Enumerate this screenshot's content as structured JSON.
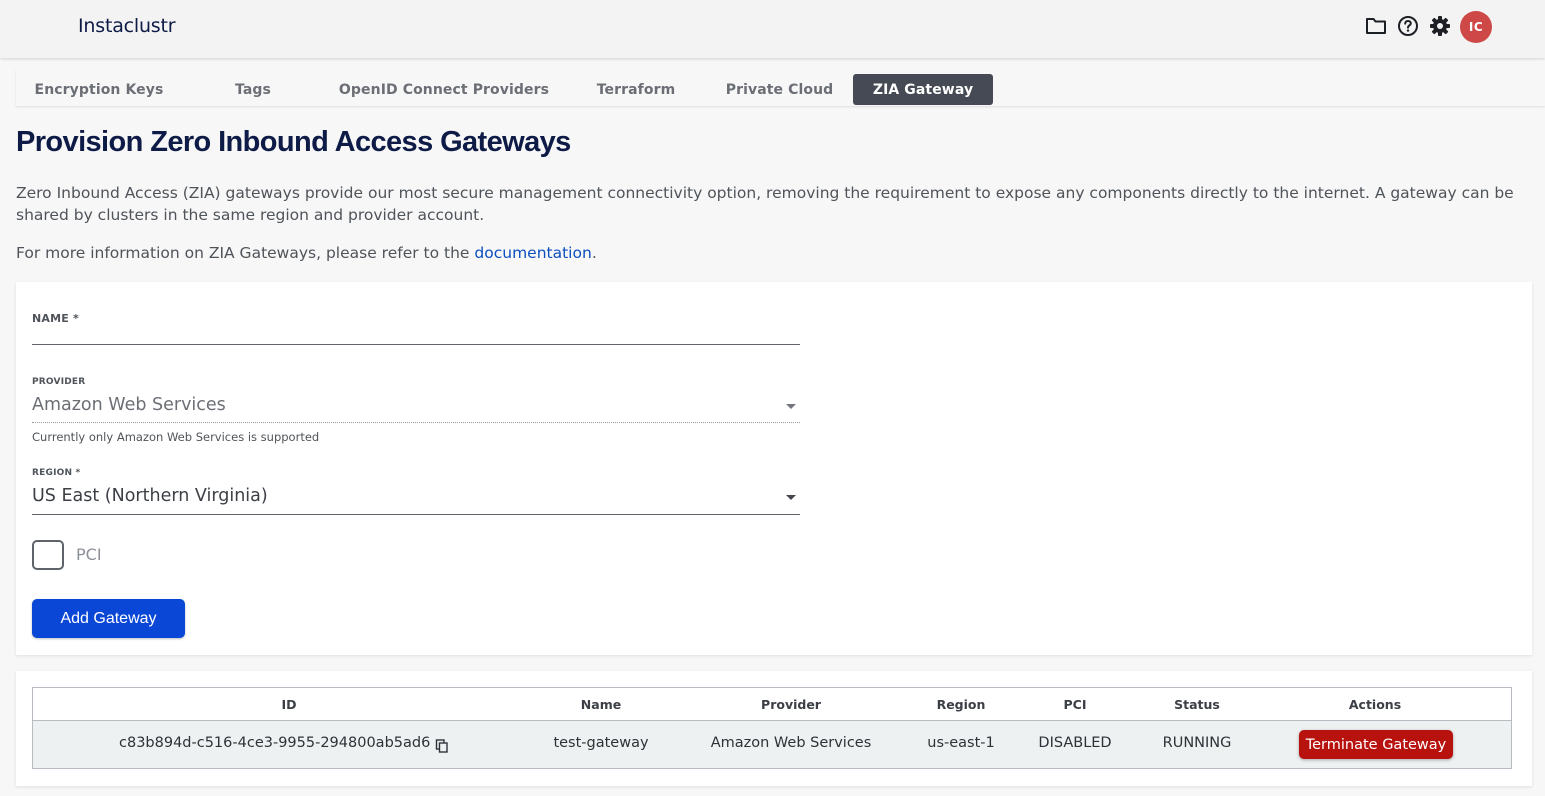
{
  "app": {
    "brand": "Instaclustr",
    "avatar_initials": "IC",
    "accent_color": "#0a47d6",
    "danger_color": "#b8120f",
    "avatar_color": "#cf4848"
  },
  "header_icons": [
    "folder-icon",
    "help-icon",
    "gear-icon"
  ],
  "tabs": [
    {
      "label": "Encryption Keys",
      "active": false
    },
    {
      "label": "Tags",
      "active": false
    },
    {
      "label": "OpenID Connect Providers",
      "active": false
    },
    {
      "label": "Terraform",
      "active": false
    },
    {
      "label": "Private Cloud",
      "active": false
    },
    {
      "label": "ZIA Gateway",
      "active": true
    }
  ],
  "page": {
    "title": "Provision Zero Inbound Access Gateways",
    "intro": "Zero Inbound Access (ZIA) gateways provide our most secure management connectivity option, removing the requirement to expose any components directly to the internet. A gateway can be shared by clusters in the same region and provider account.",
    "info_prefix": "For more information on ZIA Gateways, please refer to the ",
    "info_link": "documentation",
    "info_suffix": "."
  },
  "form": {
    "name_label": "NAME *",
    "name_value": "",
    "provider_label": "PROVIDER",
    "provider_value": "Amazon Web Services",
    "provider_helper": "Currently only Amazon Web Services is supported",
    "region_label": "REGION *",
    "region_value": "US East (Northern Virginia)",
    "pci_label": "PCI",
    "pci_checked": false,
    "submit_label": "Add Gateway"
  },
  "table": {
    "columns": [
      "ID",
      "Name",
      "Provider",
      "Region",
      "PCI",
      "Status",
      "Actions"
    ],
    "rows": [
      {
        "id": "c83b894d-c516-4ce3-9955-294800ab5ad6",
        "name": "test-gateway",
        "provider": "Amazon Web Services",
        "region": "us-east-1",
        "pci": "DISABLED",
        "status": "RUNNING",
        "action_label": "Terminate Gateway"
      }
    ]
  }
}
